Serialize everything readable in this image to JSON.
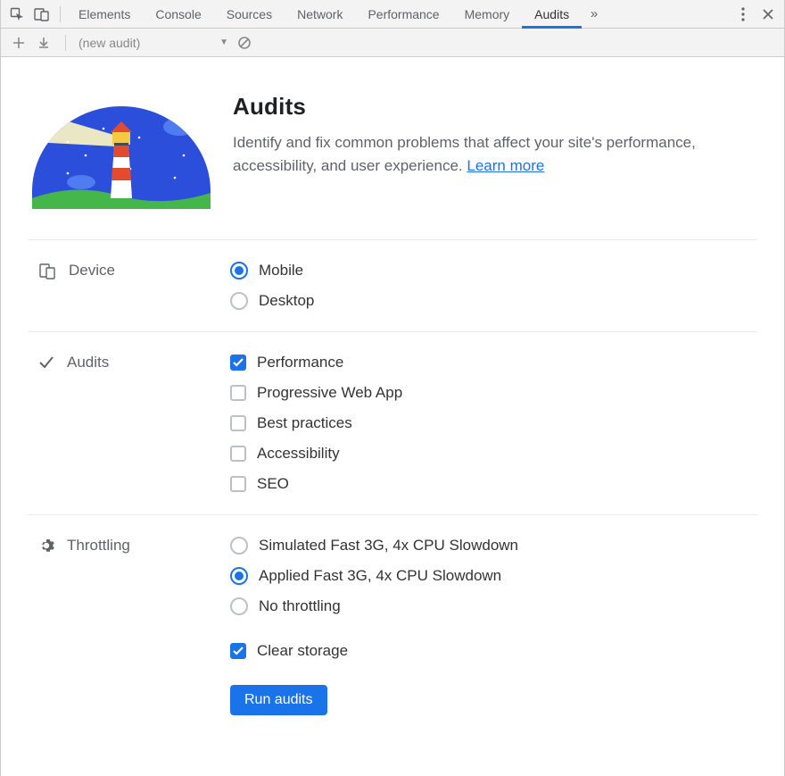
{
  "tabs": {
    "items": [
      "Elements",
      "Console",
      "Sources",
      "Network",
      "Performance",
      "Memory",
      "Audits"
    ],
    "active": "Audits"
  },
  "toolbar2": {
    "dropdown": "(new audit)"
  },
  "header": {
    "title": "Audits",
    "desc": "Identify and fix common problems that affect your site's performance, accessibility, and user experience. ",
    "learn": "Learn more"
  },
  "sections": {
    "device": {
      "label": "Device",
      "options": [
        {
          "label": "Mobile",
          "checked": true
        },
        {
          "label": "Desktop",
          "checked": false
        }
      ]
    },
    "audits": {
      "label": "Audits",
      "options": [
        {
          "label": "Performance",
          "checked": true
        },
        {
          "label": "Progressive Web App",
          "checked": false
        },
        {
          "label": "Best practices",
          "checked": false
        },
        {
          "label": "Accessibility",
          "checked": false
        },
        {
          "label": "SEO",
          "checked": false
        }
      ]
    },
    "throttling": {
      "label": "Throttling",
      "options": [
        {
          "label": "Simulated Fast 3G, 4x CPU Slowdown",
          "checked": false
        },
        {
          "label": "Applied Fast 3G, 4x CPU Slowdown",
          "checked": true
        },
        {
          "label": "No throttling",
          "checked": false
        }
      ]
    },
    "clear": {
      "label": "Clear storage",
      "checked": true
    }
  },
  "run_label": "Run audits"
}
